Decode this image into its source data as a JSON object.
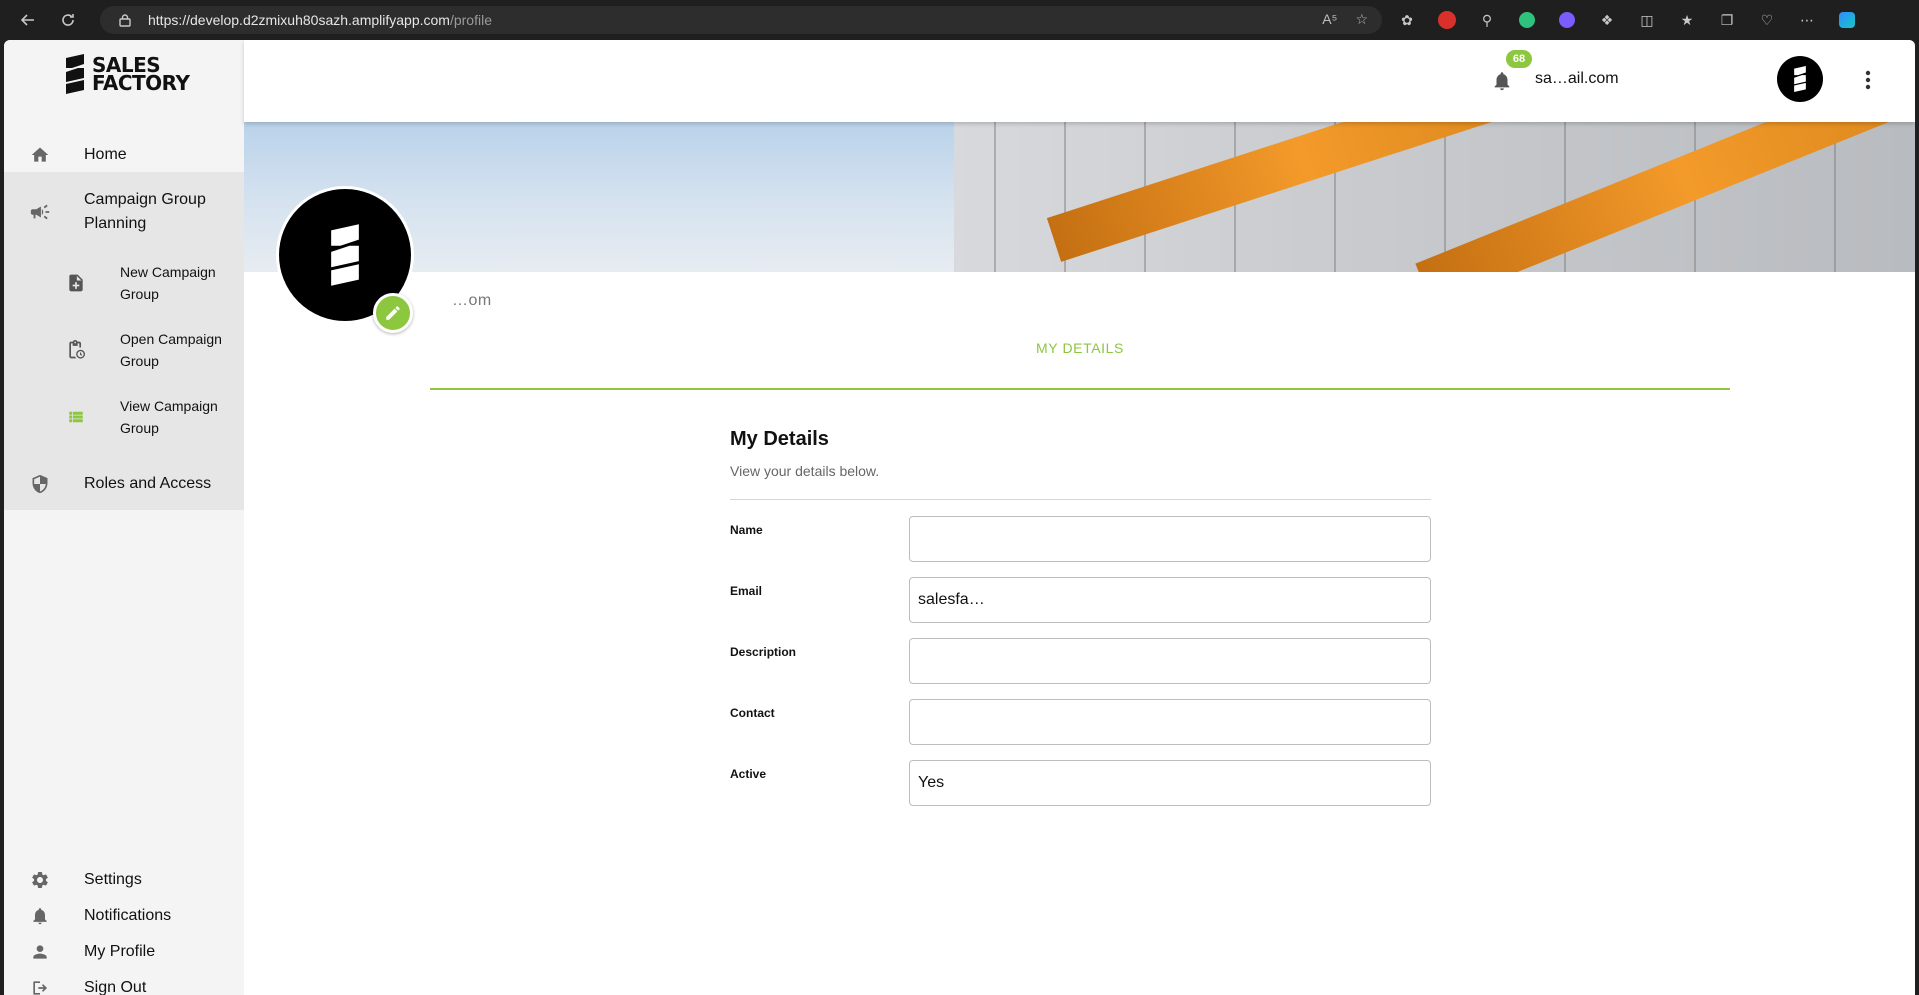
{
  "browser": {
    "url_host": "https://develop.d2zmixuh80sazh.amplifyapp.com",
    "url_path": "/profile"
  },
  "brand": {
    "line1": "SALES",
    "line2": "FACTORY"
  },
  "sidebar": {
    "home": "Home",
    "campaign_group_planning": "Campaign Group Planning",
    "sub_items": [
      "New Campaign Group",
      "Open Campaign Group",
      "View Campaign Group"
    ],
    "roles": "Roles and Access",
    "settings": "Settings",
    "notifications": "Notifications",
    "my_profile": "My Profile",
    "sign_out": "Sign Out"
  },
  "header": {
    "notification_count": "68",
    "user_email": "sa…ail.com"
  },
  "profile": {
    "email_partial": "…om"
  },
  "tabs": {
    "my_details": "MY DETAILS"
  },
  "form": {
    "title": "My Details",
    "subtitle": "View your details below.",
    "fields": [
      {
        "label": "Name",
        "value": ""
      },
      {
        "label": "Email",
        "value": "salesfa…"
      },
      {
        "label": "Description",
        "value": ""
      },
      {
        "label": "Contact",
        "value": ""
      },
      {
        "label": "Active",
        "value": "Yes"
      }
    ]
  },
  "colors": {
    "accent": "#8dc63f",
    "sidebar_bg": "#f4f4f4",
    "group_bg": "#e6e6e6"
  },
  "icons": [
    "home-icon",
    "megaphone-icon",
    "note-add-icon",
    "clipboard-clock-icon",
    "list-icon",
    "shield-icon",
    "gear-icon",
    "bell-icon",
    "person-icon",
    "logout-icon",
    "pencil-icon",
    "kebab-icon"
  ]
}
